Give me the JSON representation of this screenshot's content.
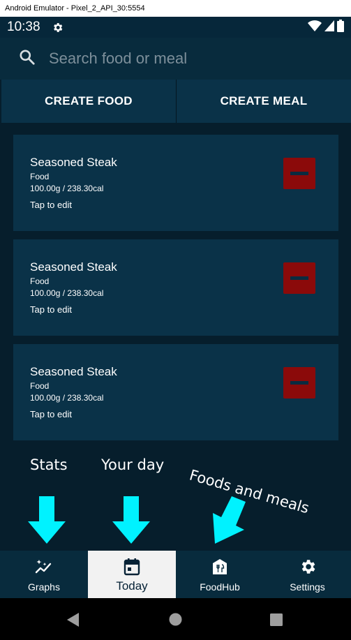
{
  "window": {
    "title": "Android Emulator - Pixel_2_API_30:5554"
  },
  "status_bar": {
    "time": "10:38",
    "icons": [
      "settings-gear-icon",
      "wifi-icon",
      "signal-icon",
      "battery-icon"
    ]
  },
  "search": {
    "placeholder": "Search food or meal",
    "icon": "search-icon"
  },
  "actions": {
    "create_food": "CREATE FOOD",
    "create_meal": "CREATE MEAL"
  },
  "items": [
    {
      "name": "Seasoned Steak",
      "type": "Food",
      "amount": "100.00g / 238.30cal",
      "hint": "Tap to edit"
    },
    {
      "name": "Seasoned Steak",
      "type": "Food",
      "amount": "100.00g / 238.30cal",
      "hint": "Tap to edit"
    },
    {
      "name": "Seasoned Steak",
      "type": "Food",
      "amount": "100.00g / 238.30cal",
      "hint": "Tap to edit"
    }
  ],
  "annotations": {
    "stats": "Stats",
    "your_day": "Your day",
    "foods_and_meals": "Foods and meals"
  },
  "bottom_nav": [
    {
      "label": "Graphs",
      "icon": "graphs-icon",
      "active": false
    },
    {
      "label": "Today",
      "icon": "calendar-icon",
      "active": true
    },
    {
      "label": "FoodHub",
      "icon": "restaurant-icon",
      "active": false
    },
    {
      "label": "Settings",
      "icon": "gear-icon",
      "active": false
    }
  ],
  "colors": {
    "background": "#061e2c",
    "card": "#0a3248",
    "remove_button": "#8b0a0a",
    "annotation_arrow": "#00f2ff",
    "active_tab": "#f2f2f2"
  }
}
